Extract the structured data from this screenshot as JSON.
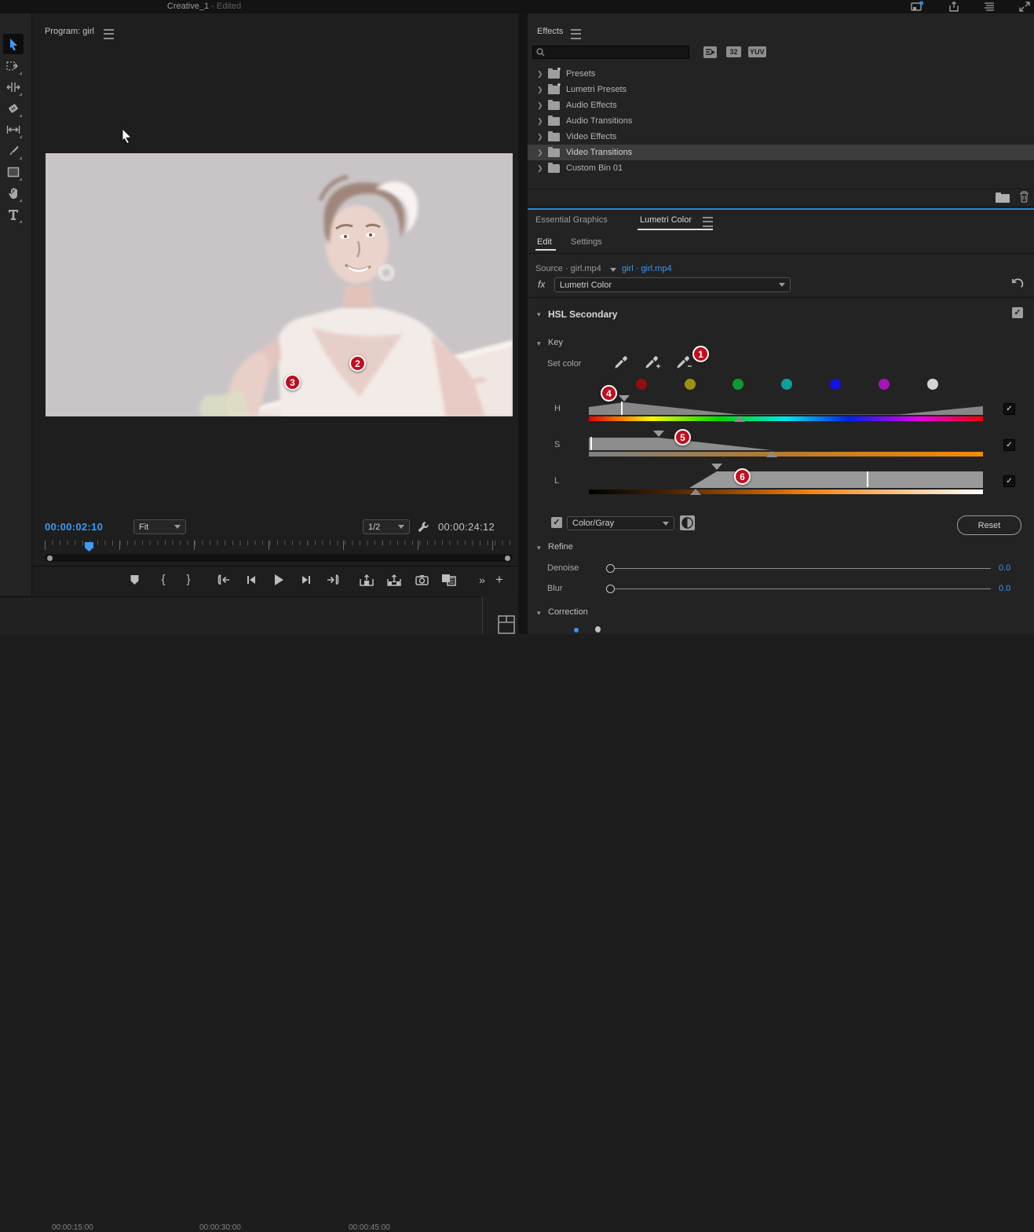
{
  "app": {
    "title": "Creative_1",
    "subtitle": "- Edited",
    "header_icons": [
      "project-icon",
      "quick-export-icon",
      "workspaces-icon",
      "fullscreen-icon"
    ]
  },
  "toolbar": {
    "tools": [
      "selection-tool",
      "track-select-forward-tool",
      "ripple-edit-tool",
      "razor-tool",
      "slip-tool",
      "pen-tool",
      "rectangle-tool",
      "hand-tool",
      "type-tool"
    ],
    "selected_tool": "selection-tool"
  },
  "program": {
    "tab_label": "Program: girl",
    "current_timecode": "00:00:02:10",
    "zoom_level": "Fit",
    "playback_resolution": "1/2",
    "duration": "00:00:24:12",
    "transport_icons": [
      "add-marker-icon",
      "mark-in-icon",
      "mark-out-icon",
      "go-to-in-icon",
      "step-back-icon",
      "play-icon",
      "step-forward-icon",
      "go-to-out-icon",
      "lift-icon",
      "extract-icon",
      "export-frame-icon",
      "comparison-view-icon",
      "more-chevrons-icon",
      "add-button-icon"
    ],
    "mark_in": "{",
    "mark_out": "}",
    "more": "»",
    "plus": "+"
  },
  "effects": {
    "tab_label": "Effects",
    "search_placeholder": "",
    "badge_32": "32",
    "badge_yuv": "YUV",
    "tree": [
      {
        "label": "Presets",
        "selected": false
      },
      {
        "label": "Lumetri Presets",
        "selected": false
      },
      {
        "label": "Audio Effects",
        "selected": false
      },
      {
        "label": "Audio Transitions",
        "selected": false
      },
      {
        "label": "Video Effects",
        "selected": false
      },
      {
        "label": "Video Transitions",
        "selected": true
      },
      {
        "label": "Custom Bin 01",
        "selected": false
      }
    ],
    "footer_icons": [
      "new-custom-bin-icon",
      "delete-icon"
    ]
  },
  "lumetri": {
    "tab_essential_graphics": "Essential Graphics",
    "tab_lumetri_color": "Lumetri Color",
    "subtab_edit": "Edit",
    "subtab_settings": "Settings",
    "source_label": "Source · girl.mp4",
    "clip_link": "girl · girl.mp4",
    "fx_label": "fx",
    "effect_name": "Lumetri Color",
    "section_hsl": "HSL Secondary",
    "section_key": "Key",
    "set_color_label": "Set color",
    "eyedroppers": [
      "eyedropper-icon",
      "eyedropper-add-icon",
      "eyedropper-subtract-icon"
    ],
    "swatch_colors": [
      "#8e1010",
      "#9a9013",
      "#0e9a2e",
      "#0f9e9a",
      "#1414e0",
      "#a714b8",
      "#d6d2d6"
    ],
    "slider_h": "H",
    "slider_s": "S",
    "slider_l": "L",
    "matte_mode": "Color/Gray",
    "reset_label": "Reset",
    "section_refine": "Refine",
    "denoise_label": "Denoise",
    "denoise_value": "0.0",
    "blur_label": "Blur",
    "blur_value": "0.0",
    "section_correction": "Correction"
  },
  "annotations": {
    "badge1": "1",
    "badge2": "2",
    "badge3": "3",
    "badge4": "4",
    "badge5": "5",
    "badge6": "6"
  },
  "timeline": {
    "tick_labels": [
      "00:00:15:00",
      "00:00:30:00",
      "00:00:45:00"
    ]
  },
  "colors": {
    "accent_blue": "#2e82d4",
    "link_blue": "#3f94e8",
    "timecode_blue": "#3a9bf4",
    "badge_red": "#c20d1e",
    "panel_bg": "#232323",
    "selected_row": "#3d3d3d",
    "preview_bg": "#c9c5c6"
  }
}
